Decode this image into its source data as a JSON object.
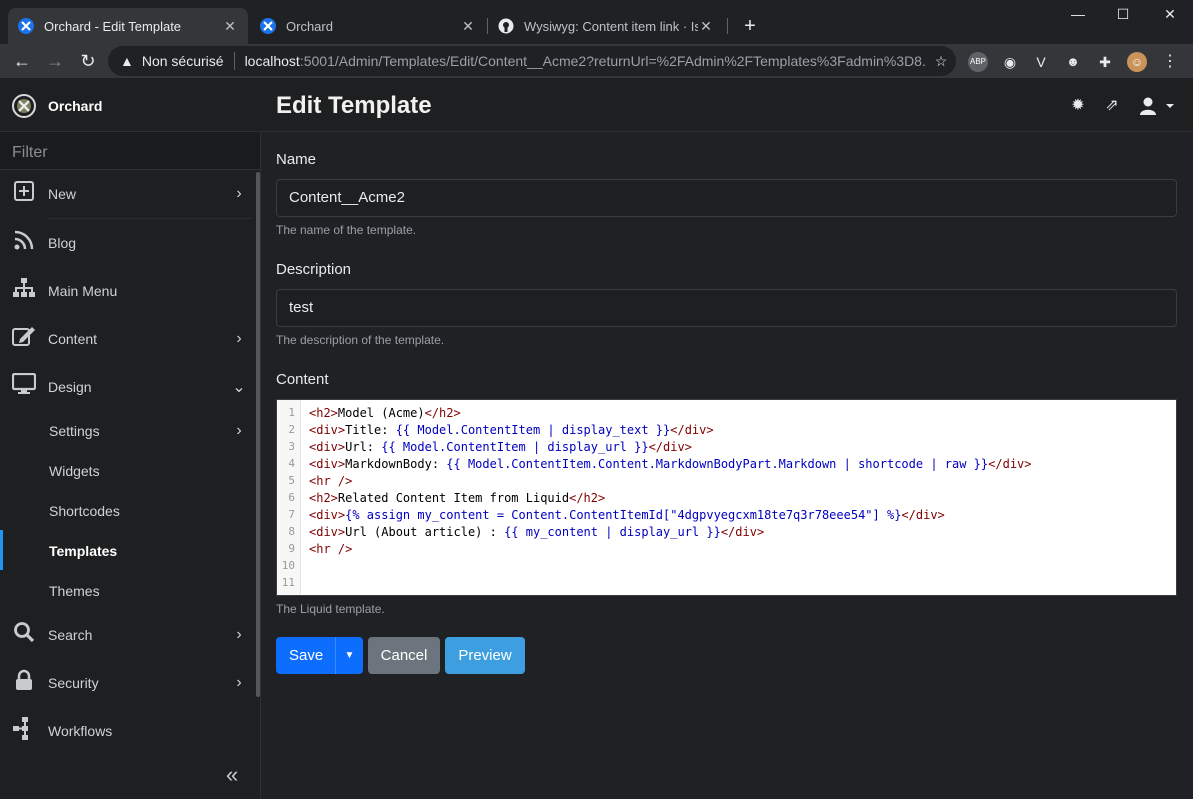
{
  "browser": {
    "tabs": [
      {
        "title": "Orchard - Edit Template",
        "active": true
      },
      {
        "title": "Orchard",
        "active": false
      },
      {
        "title": "Wysiwyg: Content item link · Issu",
        "active": false
      }
    ],
    "omnibox": {
      "security": "Non sécurisé",
      "host": "localhost",
      "path": ":5001/Admin/Templates/Edit/Content__Acme2?returnUrl=%2FAdmin%2FTemplates%3Fadmin%3D8..."
    },
    "extensions": [
      "ABP",
      "camera",
      "V",
      "owl",
      "puzzle",
      "avatar"
    ]
  },
  "app": {
    "brand": "Orchard",
    "page_title": "Edit Template"
  },
  "sidebar": {
    "filter_placeholder": "Filter",
    "items": [
      {
        "label": "New",
        "icon": "plus-square-icon",
        "chevron": "›"
      },
      {
        "label": "Blog",
        "icon": "rss-icon",
        "chevron": ""
      },
      {
        "label": "Main Menu",
        "icon": "sitemap-icon",
        "chevron": ""
      },
      {
        "label": "Content",
        "icon": "edit-icon",
        "chevron": "›"
      },
      {
        "label": "Design",
        "icon": "desktop-icon",
        "chevron": "⌄"
      }
    ],
    "design_sub": [
      {
        "label": "Settings",
        "chevron": "›"
      },
      {
        "label": "Widgets",
        "chevron": ""
      },
      {
        "label": "Shortcodes",
        "chevron": ""
      },
      {
        "label": "Templates",
        "chevron": "",
        "active": true
      },
      {
        "label": "Themes",
        "chevron": ""
      }
    ],
    "bottom_items": [
      {
        "label": "Search",
        "icon": "search-icon",
        "chevron": "›"
      },
      {
        "label": "Security",
        "icon": "lock-icon",
        "chevron": "›"
      },
      {
        "label": "Workflows",
        "icon": "workflow-icon",
        "chevron": ""
      }
    ]
  },
  "form": {
    "name_label": "Name",
    "name_value": "Content__Acme2",
    "name_hint": "The name of the template.",
    "description_label": "Description",
    "description_value": "test",
    "description_hint": "The description of the template.",
    "content_label": "Content",
    "content_hint": "The Liquid template.",
    "code_lines": [
      "<h2>Model (Acme)</h2>",
      "<div>Title: {{ Model.ContentItem | display_text }}</div>",
      "<div>Url: {{ Model.ContentItem | display_url }}</div>",
      "<div>MarkdownBody: {{ Model.ContentItem.Content.MarkdownBodyPart.Markdown | shortcode | raw }}</div>",
      "<hr />",
      "<h2>Related Content Item from Liquid</h2>",
      "<div>{% assign my_content = Content.ContentItemId[\"4dgpvyegcxm18te7q3r78eee54\"] %}</div>",
      "<div>Url (About article) : {{ my_content | display_url }}</div>",
      "<hr />",
      "",
      ""
    ]
  },
  "buttons": {
    "save": "Save",
    "cancel": "Cancel",
    "preview": "Preview"
  }
}
